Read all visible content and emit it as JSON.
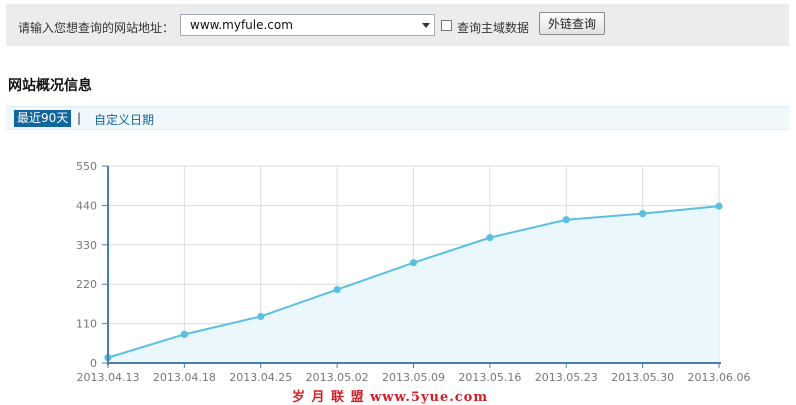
{
  "query": {
    "label": "请输入您想查询的网站地址：",
    "url_value": "www.myfule.com",
    "checkbox_label": "查询主域数据",
    "checkbox_checked": false,
    "button_label": "外链查询"
  },
  "section": {
    "title": "网站概况信息"
  },
  "range_tabs": {
    "active": "最近90天",
    "separator": "|",
    "custom": "自定义日期"
  },
  "chart_data": {
    "type": "area",
    "title": "",
    "xlabel": "",
    "ylabel": "",
    "categories": [
      "2013.04.13",
      "2013.04.18",
      "2013.04.25",
      "2013.05.02",
      "2013.05.09",
      "2013.05.16",
      "2013.05.23",
      "2013.05.30",
      "2013.06.06"
    ],
    "values": [
      15,
      80,
      130,
      205,
      280,
      350,
      400,
      417,
      438
    ],
    "y_ticks": [
      0,
      110,
      220,
      330,
      440,
      550
    ],
    "ylim": [
      0,
      550
    ],
    "grid": true,
    "legend": "none",
    "line_color": "#5bbfe2",
    "fill_color": "#eaf7fc",
    "axis_color": "#4b7ea9"
  },
  "watermark": "岁 月 联 盟  www.5yue.com"
}
